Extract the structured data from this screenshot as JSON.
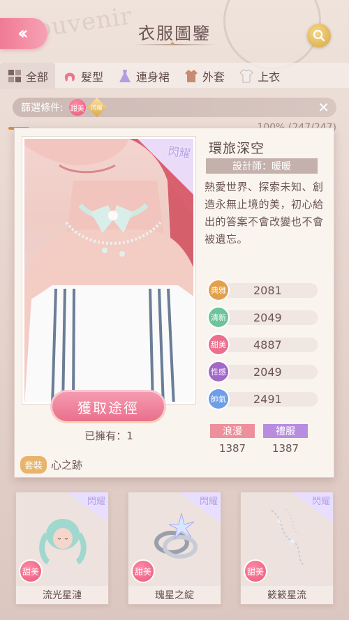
{
  "header": {
    "title": "衣服圖鑒"
  },
  "tabs": [
    {
      "label": "全部"
    },
    {
      "label": "髮型"
    },
    {
      "label": "連身裙"
    },
    {
      "label": "外套"
    },
    {
      "label": "上衣"
    }
  ],
  "filter": {
    "label": "篩選條件:",
    "chip_style": "甜美",
    "chip_rarity": "閃耀"
  },
  "progress": {
    "text": "100% (247/247)",
    "fraction": 1.0
  },
  "detail": {
    "badge": "閃耀",
    "name": "環旅深空",
    "designer": "設計師：暖暖",
    "description": "熱愛世界、探索未知、創造永無止境的美，初心給出的答案不會改變也不會被遺忘。",
    "acquire_label": "獲取途徑",
    "owned": "已擁有：1",
    "set_tag": "套裝",
    "set_name": "心之跡",
    "stats": [
      {
        "label": "典雅",
        "value": "2081",
        "color": "#e2a04d"
      },
      {
        "label": "清新",
        "value": "2049",
        "color": "#6cc49a"
      },
      {
        "label": "甜美",
        "value": "4887",
        "color": "#ec6f8e"
      },
      {
        "label": "性感",
        "value": "2049",
        "color": "#a268c8"
      },
      {
        "label": "帥氣",
        "value": "2491",
        "color": "#6e9ee6"
      }
    ],
    "tags": [
      {
        "label": "浪漫",
        "value": "1387",
        "color": "#ee8f9c"
      },
      {
        "label": "禮服",
        "value": "1387",
        "color": "#b88de0"
      }
    ]
  },
  "thumbnails": [
    {
      "badge": "閃耀",
      "style": "甜美",
      "name": "流光星漣",
      "icon": "hairstyle-icon"
    },
    {
      "badge": "閃耀",
      "style": "甜美",
      "name": "瑰星之綻",
      "icon": "rings-icon"
    },
    {
      "badge": "閃耀",
      "style": "甜美",
      "name": "簌簌星流",
      "icon": "chain-icon"
    }
  ]
}
